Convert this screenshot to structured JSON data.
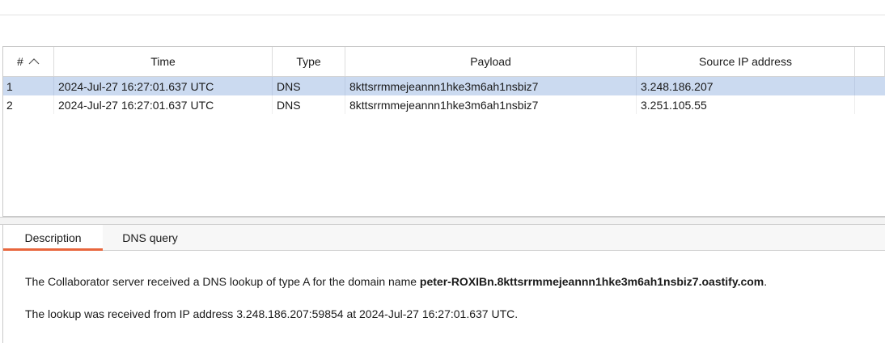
{
  "table": {
    "headers": {
      "num": "#",
      "time": "Time",
      "type": "Type",
      "payload": "Payload",
      "source_ip": "Source IP address"
    },
    "sort_icon": "chevron-up-icon",
    "rows": [
      {
        "num": "1",
        "time": "2024-Jul-27 16:27:01.637 UTC",
        "type": "DNS",
        "payload": "8kttsrrmmejeannn1hke3m6ah1nsbiz7",
        "source_ip": "3.248.186.207",
        "selected": true
      },
      {
        "num": "2",
        "time": "2024-Jul-27 16:27:01.637 UTC",
        "type": "DNS",
        "payload": "8kttsrrmmejeannn1hke3m6ah1nsbiz7",
        "source_ip": "3.251.105.55",
        "selected": false
      }
    ]
  },
  "detail": {
    "tabs": [
      {
        "label": "Description",
        "active": true
      },
      {
        "label": "DNS query",
        "active": false
      }
    ],
    "description": {
      "line1_prefix": "The Collaborator server received a DNS lookup of type A for the domain name ",
      "line1_domain": "peter-ROXIBn.8kttsrrmmejeannn1hke3m6ah1nsbiz7.oastify.com",
      "line1_suffix": ".",
      "line2": "The lookup was received from IP address 3.248.186.207:59854 at 2024-Jul-27 16:27:01.637 UTC."
    }
  },
  "colors": {
    "selected_row": "#cbdaf0",
    "active_tab_underline": "#e8663d"
  }
}
